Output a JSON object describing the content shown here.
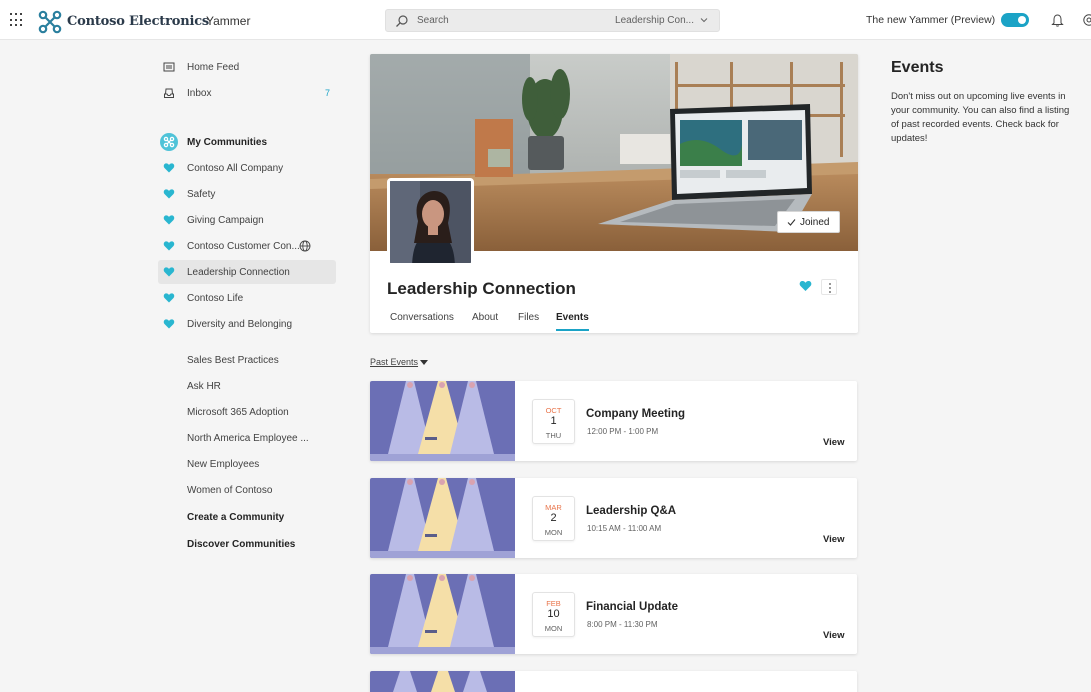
{
  "header": {
    "org_name": "Contoso Electronics",
    "app_name": "Yammer",
    "search": {
      "placeholder": "Search",
      "scope": "Leadership Con..."
    },
    "preview_label": "The new Yammer (Preview)",
    "preview_toggle_on": true
  },
  "sidebar": {
    "home_feed": "Home Feed",
    "inbox": {
      "label": "Inbox",
      "count": "7"
    },
    "my_communities": "My Communities",
    "favorites": [
      {
        "label": "Contoso All Company"
      },
      {
        "label": "Safety"
      },
      {
        "label": "Giving Campaign"
      },
      {
        "label": "Contoso Customer Con..."
      },
      {
        "label": "Leadership Connection"
      },
      {
        "label": "Contoso Life"
      },
      {
        "label": "Diversity and Belonging"
      }
    ],
    "communities": [
      {
        "label": "Sales Best Practices"
      },
      {
        "label": "Ask HR"
      },
      {
        "label": "Microsoft 365 Adoption"
      },
      {
        "label": "North America Employee ..."
      },
      {
        "label": "New Employees"
      },
      {
        "label": "Women of Contoso"
      }
    ],
    "create_community": "Create a Community",
    "discover_communities": "Discover Communities"
  },
  "community": {
    "title": "Leadership Connection",
    "joined_label": "Joined",
    "tabs": [
      {
        "label": "Conversations"
      },
      {
        "label": "About"
      },
      {
        "label": "Files"
      },
      {
        "label": "Events"
      }
    ],
    "active_tab": "Events"
  },
  "events_filter": {
    "label": "Past Events"
  },
  "events": [
    {
      "month": "OCT",
      "day": "1",
      "weekday": "THU",
      "title": "Company Meeting",
      "time": "12:00 PM - 1:00 PM",
      "action": "View"
    },
    {
      "month": "MAR",
      "day": "2",
      "weekday": "MON",
      "title": "Leadership Q&A",
      "time": "10:15 AM - 11:00 AM",
      "action": "View"
    },
    {
      "month": "FEB",
      "day": "10",
      "weekday": "MON",
      "title": "Financial Update",
      "time": "8:00 PM - 11:30 PM",
      "action": "View"
    }
  ],
  "right_panel": {
    "title": "Events",
    "description": "Don't miss out on upcoming live events in your community. You can also find a listing of past recorded events. Check back for updates!"
  },
  "colors": {
    "accent": "#1ba3c6",
    "event_banner": "#6b6fb5",
    "month_text": "#e8744a"
  }
}
